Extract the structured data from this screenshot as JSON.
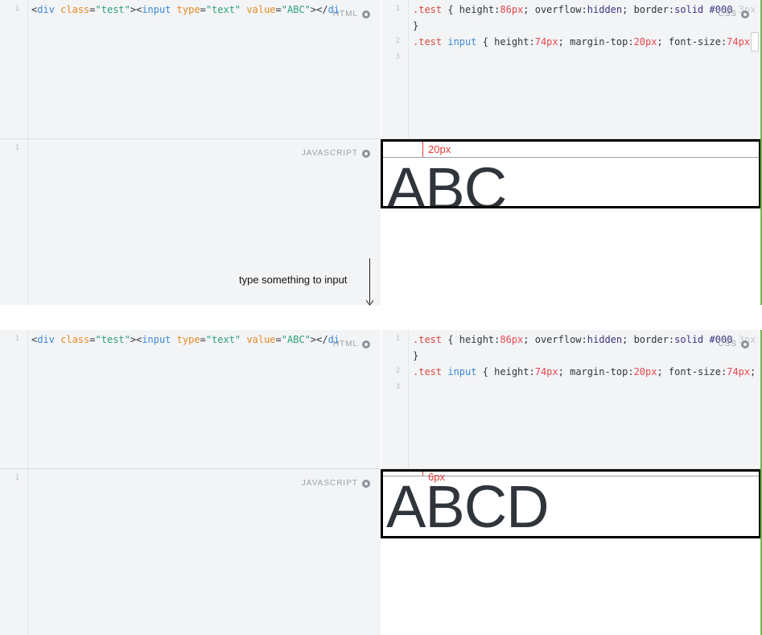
{
  "editor": {
    "html_label": "HTML",
    "css_label": "CSS",
    "js_label": "JAVASCRIPT",
    "html_line_numbers": [
      "1"
    ],
    "css_line_numbers": [
      "1",
      "2",
      "3"
    ],
    "js_line_numbers": [
      "1"
    ],
    "html_code": {
      "p1": "<",
      "tag_div": "div",
      "attr_class": " class",
      "eq1": "=",
      "str_test": "\"test\"",
      "p2": "><",
      "tag_input": "input",
      "attr_type": " type",
      "eq2": "=",
      "str_text": "\"text\"",
      "attr_value": " value",
      "eq3": "=",
      "str_abc": "\"ABC\"",
      "p3": "></",
      "tag_close": "di"
    },
    "css_code": {
      "l1_sel": ".test",
      "l1_a": " { height:",
      "l1_n1": "86px",
      "l1_b": "; overflow:",
      "l1_kw1": "hidden",
      "l1_c": "; border:",
      "l1_kw2": "solid",
      "l1_d": " ",
      "l1_kw3": "#000",
      "l1_fade": " 3px",
      "l1_close": "}",
      "l2_sel": ".test",
      "l2_tag": " input",
      "l2_a": " { height:",
      "l2_n1": "74px",
      "l2_b": "; margin-top:",
      "l2_n2": "20px",
      "l2_c": "; font-size:",
      "l2_n3": "74px",
      "l2_d": "; }"
    },
    "icons": [
      "gear-icon"
    ]
  },
  "before": {
    "measure_label": "20px",
    "input_value": "ABC"
  },
  "after": {
    "measure_label": "6px",
    "input_value": "ABCD"
  },
  "annotation": {
    "instruction": "type something to input"
  },
  "colors": {
    "measure": "#e53935",
    "border": "#000000",
    "green_edge": "#6dbb4e"
  }
}
